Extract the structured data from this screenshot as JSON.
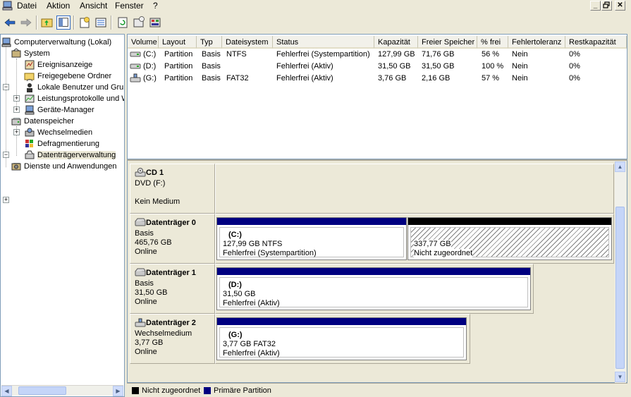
{
  "menu": {
    "items": [
      "Datei",
      "Aktion",
      "Ansicht",
      "Fenster",
      "?"
    ],
    "window_buttons": [
      "minimize-icon",
      "restore-icon",
      "close-icon"
    ]
  },
  "toolbar": {
    "buttons": [
      "back-arrow-icon",
      "forward-arrow-icon",
      "up-folder-icon",
      "show-hide-tree-icon",
      "properties-icon",
      "refresh-icon",
      "export-list-icon",
      "help-icon",
      "disk-icon"
    ]
  },
  "tree": {
    "root": "Computerverwaltung (Lokal)",
    "system": "System",
    "system_children": [
      "Ereignisanzeige",
      "Freigegebene Ordner",
      "Lokale Benutzer und Grup",
      "Leistungsprotokolle und W",
      "Geräte-Manager"
    ],
    "storage": "Datenspeicher",
    "storage_children": [
      "Wechselmedien",
      "Defragmentierung",
      "Datenträgerverwaltung"
    ],
    "services": "Dienste und Anwendungen"
  },
  "volumes": {
    "columns": [
      "Volume",
      "Layout",
      "Typ",
      "Dateisystem",
      "Status",
      "Kapazität",
      "Freier Speicher",
      "% frei",
      "Fehlertoleranz",
      "Restkapazität"
    ],
    "rows": [
      [
        "(C:)",
        "Partition",
        "Basis",
        "NTFS",
        "Fehlerfrei (Systempartition)",
        "127,99 GB",
        "71,76 GB",
        "56 %",
        "Nein",
        "0%"
      ],
      [
        "(D:)",
        "Partition",
        "Basis",
        "",
        "Fehlerfrei (Aktiv)",
        "31,50 GB",
        "31,50 GB",
        "100 %",
        "Nein",
        "0%"
      ],
      [
        "(G:)",
        "Partition",
        "Basis",
        "FAT32",
        "Fehlerfrei (Aktiv)",
        "3,76 GB",
        "2,16 GB",
        "57 %",
        "Nein",
        "0%"
      ]
    ]
  },
  "disks": {
    "cd1": {
      "title": "CD 1",
      "line1": "DVD (F:)",
      "line2": "Kein Medium"
    },
    "disk0": {
      "title": "Datenträger 0",
      "type": "Basis",
      "size": "465,76 GB",
      "status": "Online",
      "part_c": {
        "name": "(C:)",
        "size": "127,99 GB NTFS",
        "status": "Fehlerfrei (Systempartition)"
      },
      "unalloc": {
        "size": "337,77 GB",
        "status": "Nicht zugeordnet"
      }
    },
    "disk1": {
      "title": "Datenträger 1",
      "type": "Basis",
      "size": "31,50 GB",
      "status": "Online",
      "part_d": {
        "name": "(D:)",
        "size": "31,50 GB",
        "status": "Fehlerfrei (Aktiv)"
      }
    },
    "disk2": {
      "title": "Datenträger 2",
      "type": "Wechselmedium",
      "size": "3,77 GB",
      "status": "Online",
      "part_g": {
        "name": "(G:)",
        "size": "3,77 GB FAT32",
        "status": "Fehlerfrei (Aktiv)"
      }
    }
  },
  "legend": {
    "unallocated": "Nicht zugeordnet",
    "primary": "Primäre Partition",
    "unallocated_color": "#000000",
    "primary_color": "#000080"
  }
}
